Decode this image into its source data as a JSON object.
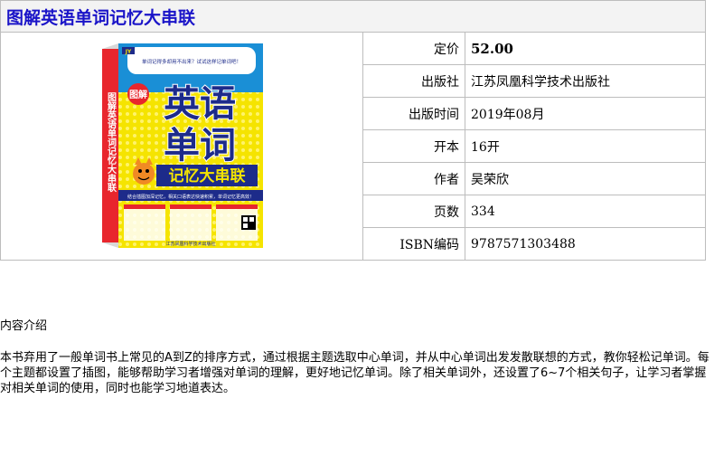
{
  "page": {
    "title": "图解英语单词记忆大串联"
  },
  "cover": {
    "spine_text": "图解英语单词记忆大串联",
    "badge_logo": "JY",
    "cover_tag": "图解",
    "cover_title_line1": "英语",
    "cover_title_line2": "单词",
    "cover_subtitle": "记忆大串联",
    "top_bubble": "单词记得多却用不出来？试试这样记单词吧！",
    "banner": "结合插图加深记忆，相关口语表达快速积累，单词记忆更高效！",
    "publisher_mark": "江苏凤凰科学技术出版社"
  },
  "details": [
    {
      "label": "定价",
      "value": "52.00"
    },
    {
      "label": "出版社",
      "value": "江苏凤凰科学技术出版社"
    },
    {
      "label": "出版时间",
      "value": "2019年08月"
    },
    {
      "label": "开本",
      "value": "16开"
    },
    {
      "label": "作者",
      "value": "吴荣欣"
    },
    {
      "label": "页数",
      "value": "334"
    },
    {
      "label": "ISBN编码",
      "value": "9787571303488"
    }
  ],
  "intro": {
    "heading": "内容介绍",
    "body": "本书弃用了一般单词书上常见的A到Z的排序方式，通过根据主题选取中心单词，并从中心单词出发发散联想的方式，教你轻松记单词。每个主题都设置了插图，能够帮助学习者增强对单词的理解，更好地记忆单词。除了相关单词外，还设置了6~7个相关句子，让学习者掌握对相关单词的使用，同时也能学习地道表达。"
  },
  "colors": {
    "title": "#1a14c8",
    "cover_yellow": "#f5e400",
    "cover_blue": "#1a8fd6",
    "cover_red": "#e8262d",
    "cover_navy": "#1d2b8a"
  }
}
